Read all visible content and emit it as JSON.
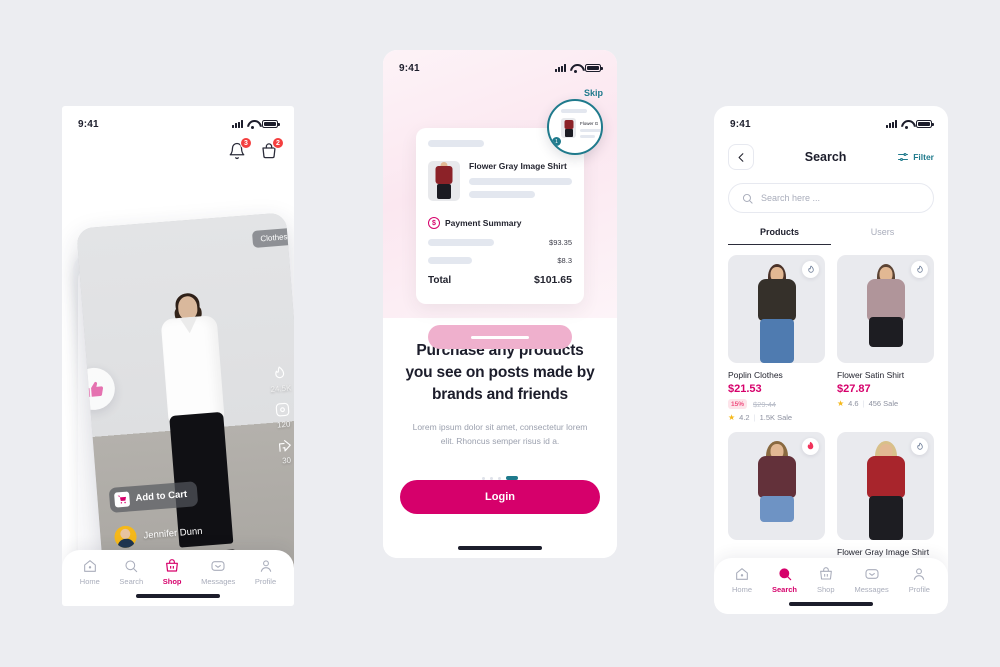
{
  "background_color": "#ecedf1",
  "accent_color": "#d6006b",
  "teal_color": "#1f7a8c",
  "screens": {
    "feed": {
      "name": "Shop Feed",
      "status": {
        "time": "9:41"
      },
      "header": {
        "notifications_badge": "3",
        "cart_badge": "2"
      },
      "card": {
        "category_chip": "Clothes",
        "add_to_cart": "Add to Cart",
        "author": "Jennifer Dunn",
        "likes": "24.5K",
        "comments": "120",
        "shares": "30"
      },
      "tabs": [
        {
          "label": "Home",
          "icon": "home-icon",
          "active": false
        },
        {
          "label": "Search",
          "icon": "search-icon",
          "active": false
        },
        {
          "label": "Shop",
          "icon": "basket-icon",
          "active": true
        },
        {
          "label": "Messages",
          "icon": "message-icon",
          "active": false
        },
        {
          "label": "Profile",
          "icon": "person-icon",
          "active": false
        }
      ]
    },
    "onboarding": {
      "name": "Onboarding",
      "status": {
        "time": "9:41"
      },
      "skip_label": "Skip",
      "receipt": {
        "product_title": "Flower Gray Image Shirt",
        "payment_summary_label": "Payment Summary",
        "line_items": [
          {
            "amount": "$93.35"
          },
          {
            "amount": "$8.3"
          }
        ],
        "total_label": "Total",
        "total_amount": "$101.65"
      },
      "magnifier": {
        "product_title": "Flower G",
        "badge": "1"
      },
      "heading": "Purchase any products you see on posts made by brands and friends",
      "subtext": "Lorem ipsum dolor sit amet, consectetur lorem elit. Rhoncus semper risus id a.",
      "pager": {
        "total": 4,
        "current": 4
      },
      "login_label": "Login"
    },
    "search": {
      "name": "Search",
      "status": {
        "time": "9:41"
      },
      "title": "Search",
      "back_icon": "chevron-left-icon",
      "filter_label": "Filter",
      "search_placeholder": "Search here ...",
      "tabs": [
        {
          "label": "Products",
          "active": true
        },
        {
          "label": "Users",
          "active": false
        }
      ],
      "products": [
        {
          "name": "Poplin Clothes",
          "price": "$21.53",
          "discount": "15%",
          "old_price": "$29.44",
          "rating": "4.2",
          "sales": "1.5K Sale",
          "liked": false,
          "hair": "#4a3228",
          "top": "#35302a",
          "bottom": "#4f7bb0"
        },
        {
          "name": "Flower Satin Shirt",
          "price": "$27.87",
          "discount": "",
          "old_price": "",
          "rating": "4.6",
          "sales": "456 Sale",
          "liked": false,
          "hair": "#5c4434",
          "top": "#b0959a",
          "bottom": "#1d1d22"
        },
        {
          "name": "",
          "price": "",
          "discount": "",
          "old_price": "",
          "rating": "",
          "sales": "",
          "liked": true,
          "hair": "#8a6a40",
          "top": "#63313a",
          "bottom": "#6e93c4"
        },
        {
          "name": "Flower Gray Image Shirt",
          "price": "",
          "discount": "",
          "old_price": "",
          "rating": "",
          "sales": "",
          "liked": false,
          "hair": "#d8c08a",
          "top": "#a8252c",
          "bottom": "#1d1d22"
        }
      ],
      "tabs_bottom": [
        {
          "label": "Home",
          "icon": "home-icon",
          "active": false
        },
        {
          "label": "Search",
          "icon": "search-icon",
          "active": true
        },
        {
          "label": "Shop",
          "icon": "basket-icon",
          "active": false
        },
        {
          "label": "Messages",
          "icon": "message-icon",
          "active": false
        },
        {
          "label": "Profile",
          "icon": "person-icon",
          "active": false
        }
      ]
    }
  }
}
